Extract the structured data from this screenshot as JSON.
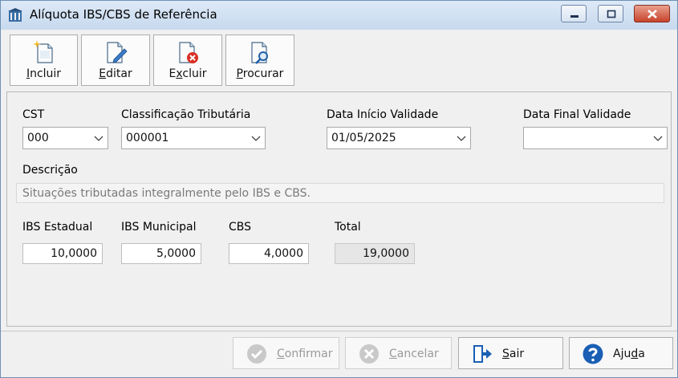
{
  "window": {
    "title": "Alíquota IBS/CBS de Referência"
  },
  "toolbar": {
    "incluir": {
      "first": "I",
      "rest": "ncluir"
    },
    "editar": {
      "first": "E",
      "rest": "ditar"
    },
    "excluir": {
      "pre": "E",
      "first": "x",
      "rest": "cluir"
    },
    "procurar": {
      "first": "P",
      "rest": "rocurar"
    }
  },
  "fields": {
    "cst": {
      "label": "CST",
      "value": "000"
    },
    "classificacao": {
      "label": "Classificação Tributária",
      "value": "000001"
    },
    "data_inicio": {
      "label": "Data Início Validade",
      "value": "01/05/2025"
    },
    "data_final": {
      "label": "Data Final Validade",
      "value": ""
    },
    "descricao": {
      "label": "Descrição",
      "value": "Situações tributadas integralmente pelo IBS e CBS."
    },
    "ibs_estadual": {
      "label": "IBS Estadual",
      "value": "10,0000"
    },
    "ibs_municipal": {
      "label": "IBS Municipal",
      "value": "5,0000"
    },
    "cbs": {
      "label": "CBS",
      "value": "4,0000"
    },
    "total": {
      "label": "Total",
      "value": "19,0000"
    }
  },
  "buttons": {
    "confirmar": {
      "first": "C",
      "rest": "onfirmar",
      "disabled": true
    },
    "cancelar": {
      "first": "C",
      "rest": "ancelar",
      "disabled": true
    },
    "sair": {
      "first": "S",
      "rest": "air"
    },
    "ajuda": {
      "pre": "Aju",
      "first": "d",
      "rest": "a"
    }
  },
  "icons": {
    "app": "building-icon",
    "incluir": "new-document-icon",
    "editar": "edit-document-icon",
    "excluir": "delete-document-icon",
    "procurar": "search-document-icon",
    "confirmar": "check-circle-icon",
    "cancelar": "x-circle-icon",
    "sair": "exit-door-icon",
    "ajuda": "help-circle-icon"
  },
  "colors": {
    "titlebar": "#c7d9ee",
    "close": "#c8432b",
    "help": "#1a5fb4",
    "exit": "#1a5fb4"
  }
}
